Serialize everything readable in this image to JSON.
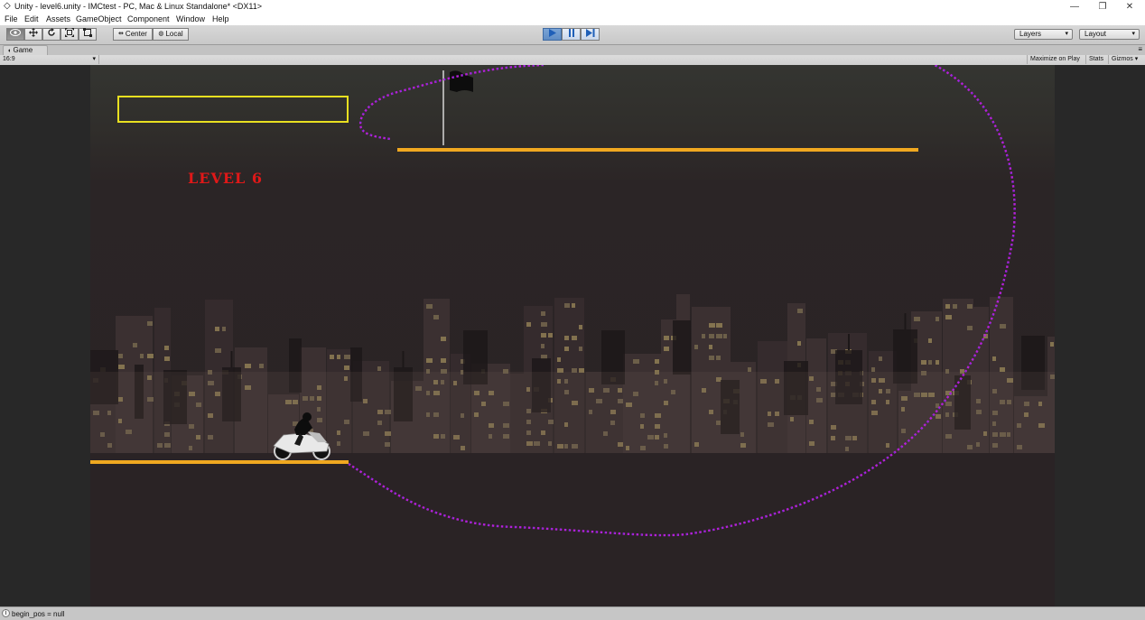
{
  "window": {
    "title": "Unity - level6.unity - IMCtest - PC, Mac & Linux Standalone* <DX11>",
    "controls": [
      "—",
      "❐",
      "✕"
    ]
  },
  "menu": [
    "File",
    "Edit",
    "Assets",
    "GameObject",
    "Component",
    "Window",
    "Help"
  ],
  "toolbar": {
    "pivot_label": "Center",
    "space_label": "Local",
    "layers_label": "Layers",
    "layout_label": "Layout"
  },
  "game_panel": {
    "tab_label": "Game",
    "aspect_label": "16:9",
    "maximize_label": "Maximize on Play",
    "stats_label": "Stats",
    "gizmos_label": "Gizmos"
  },
  "game": {
    "level_text": "LEVEL 6",
    "colors": {
      "platform": "#f0a820",
      "trajectory": "#b420d8",
      "outline_box": "#e8e020",
      "level_text": "#e01818"
    }
  },
  "status": {
    "message": "begin_pos = null"
  }
}
